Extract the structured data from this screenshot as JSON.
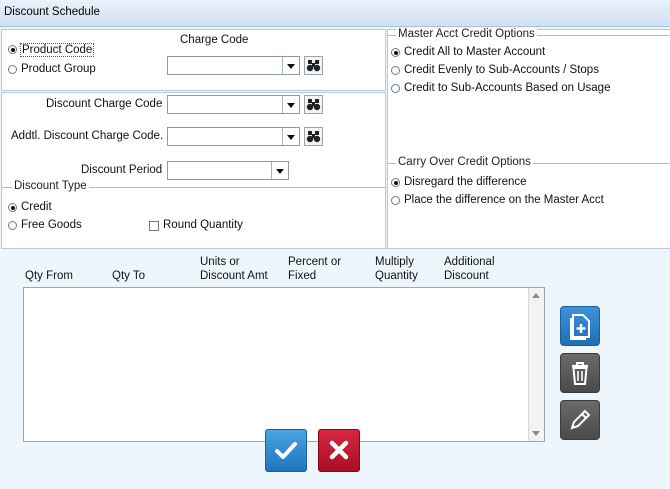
{
  "window": {
    "title": "Discount Schedule"
  },
  "product": {
    "charge_code_label": "Charge Code",
    "options": [
      "Product Code",
      "Product Group"
    ],
    "selected": 0,
    "charge_code_value": ""
  },
  "discount": {
    "charge_code_label": "Discount Charge Code",
    "charge_code_value": "",
    "addl_charge_code_label": "Addtl. Discount Charge Code.",
    "addl_charge_code_value": "",
    "period_label": "Discount Period",
    "period_value": ""
  },
  "discount_type": {
    "title": "Discount Type",
    "options": [
      "Credit",
      "Free Goods"
    ],
    "selected": 0,
    "round_quantity_label": "Round Quantity",
    "round_quantity_checked": false
  },
  "master_acct": {
    "title": "Master Acct Credit Options",
    "options": [
      "Credit All to Master Account",
      "Credit Evenly to Sub-Accounts / Stops",
      "Credit to Sub-Accounts Based on Usage"
    ],
    "selected": 0
  },
  "carry_over": {
    "title": "Carry Over Credit Options",
    "options": [
      "Disregard the difference",
      "Place the difference on the Master Acct"
    ],
    "selected": 0
  },
  "grid": {
    "columns": [
      {
        "line1": "Qty From",
        "line2": ""
      },
      {
        "line1": "Qty To",
        "line2": ""
      },
      {
        "line1": "Units or",
        "line2": "Discount Amt"
      },
      {
        "line1": "Percent or",
        "line2": "Fixed"
      },
      {
        "line1": "Multiply",
        "line2": "Quantity"
      },
      {
        "line1": "Additional",
        "line2": "Discount"
      }
    ],
    "rows": []
  },
  "icons": {
    "binoculars": "binoculars-icon",
    "add": "add-document-icon",
    "delete": "trash-icon",
    "edit": "pencil-icon",
    "ok": "checkmark-icon",
    "cancel": "x-icon"
  },
  "colors": {
    "ok": "#2f8fd4",
    "cancel": "#c8102e",
    "side": "#5a5a5a",
    "add": "#2e7fc4"
  }
}
